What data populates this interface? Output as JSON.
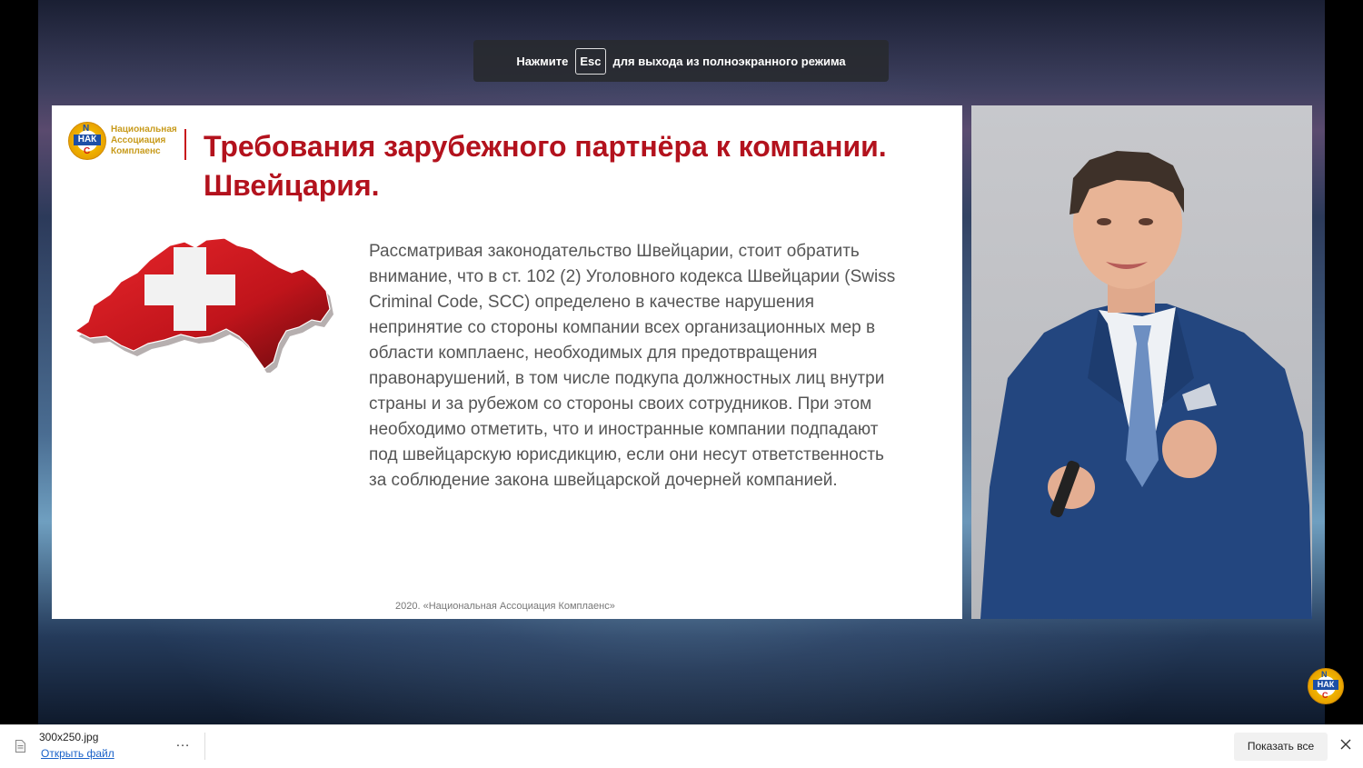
{
  "toast": {
    "prefix": "Нажмите",
    "key": "Esc",
    "suffix": "для выхода из полноэкранного режима"
  },
  "slide": {
    "logo": {
      "letter_top": "N",
      "letters_mid": "НАК",
      "letter_bottom": "С",
      "line1": "Национальная",
      "line2": "Ассоциация",
      "line3": "Комплаенс"
    },
    "title": "Требования зарубежного партнёра к компании. Швейцария.",
    "body": "Рассматривая законодательство Швейцарии, стоит обратить внимание, что в ст. 102 (2) Уголовного кодекса Швейцарии (Swiss Criminal Code, SCC) определено в качестве нарушения непринятие со стороны компании всех организационных мер в области комплаенс, необходимых для предотвращения правонарушений, в том числе подкупа должностных лиц внутри страны и за рубежом со стороны своих сотрудников. При этом необходимо отметить, что и иностранные компании подпадают под швейцарскую юрисдикцию, если они несут ответственность за соблюдение закона швейцарской дочерней компанией.",
    "footer": "2020. «Национальная Ассоциация Комплаенс»"
  },
  "corner_logo": {
    "letter_top": "N",
    "letters_mid": "НАК",
    "letter_bottom": "С"
  },
  "download_bar": {
    "file_name": "300x250.jpg",
    "open_label": "Открыть файл",
    "more_label": "…",
    "show_all_label": "Показать все"
  },
  "colors": {
    "title_red": "#b3121d",
    "flag_red": "#d11a1f",
    "link_blue": "#1a62c9"
  }
}
